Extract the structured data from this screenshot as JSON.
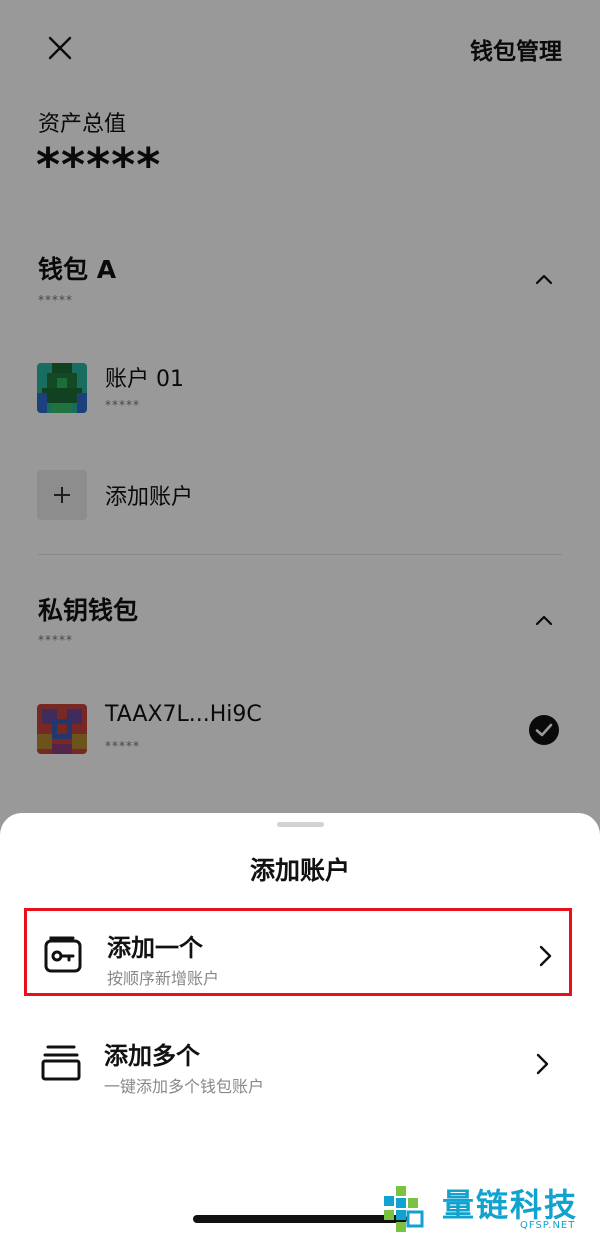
{
  "header": {
    "title": "钱包管理",
    "close_icon": "close-icon"
  },
  "assets": {
    "label": "资产总值",
    "value": "*****"
  },
  "wallets": [
    {
      "title": "钱包 A",
      "subtitle": "*****",
      "accounts": [
        {
          "name": "账户 01",
          "subtitle": "*****"
        }
      ],
      "add_label": "添加账户"
    },
    {
      "title": "私钥钱包",
      "subtitle": "*****",
      "accounts": [
        {
          "name": "TAAX7L...Hi9C",
          "subtitle": "*****",
          "selected": true
        }
      ]
    }
  ],
  "sheet": {
    "title": "添加账户",
    "options": [
      {
        "title": "添加一个",
        "subtitle": "按顺序新增账户",
        "icon": "wallet-key-icon",
        "highlighted": true
      },
      {
        "title": "添加多个",
        "subtitle": "一键添加多个钱包账户",
        "icon": "stack-icon",
        "highlighted": false
      }
    ]
  },
  "watermark": {
    "text": "量链科技",
    "sub": "QFSP.NET"
  },
  "colors": {
    "highlight": "#e8101c",
    "watermark": "#11a2cf",
    "overlay": "rgba(0,0,0,0.40)"
  }
}
